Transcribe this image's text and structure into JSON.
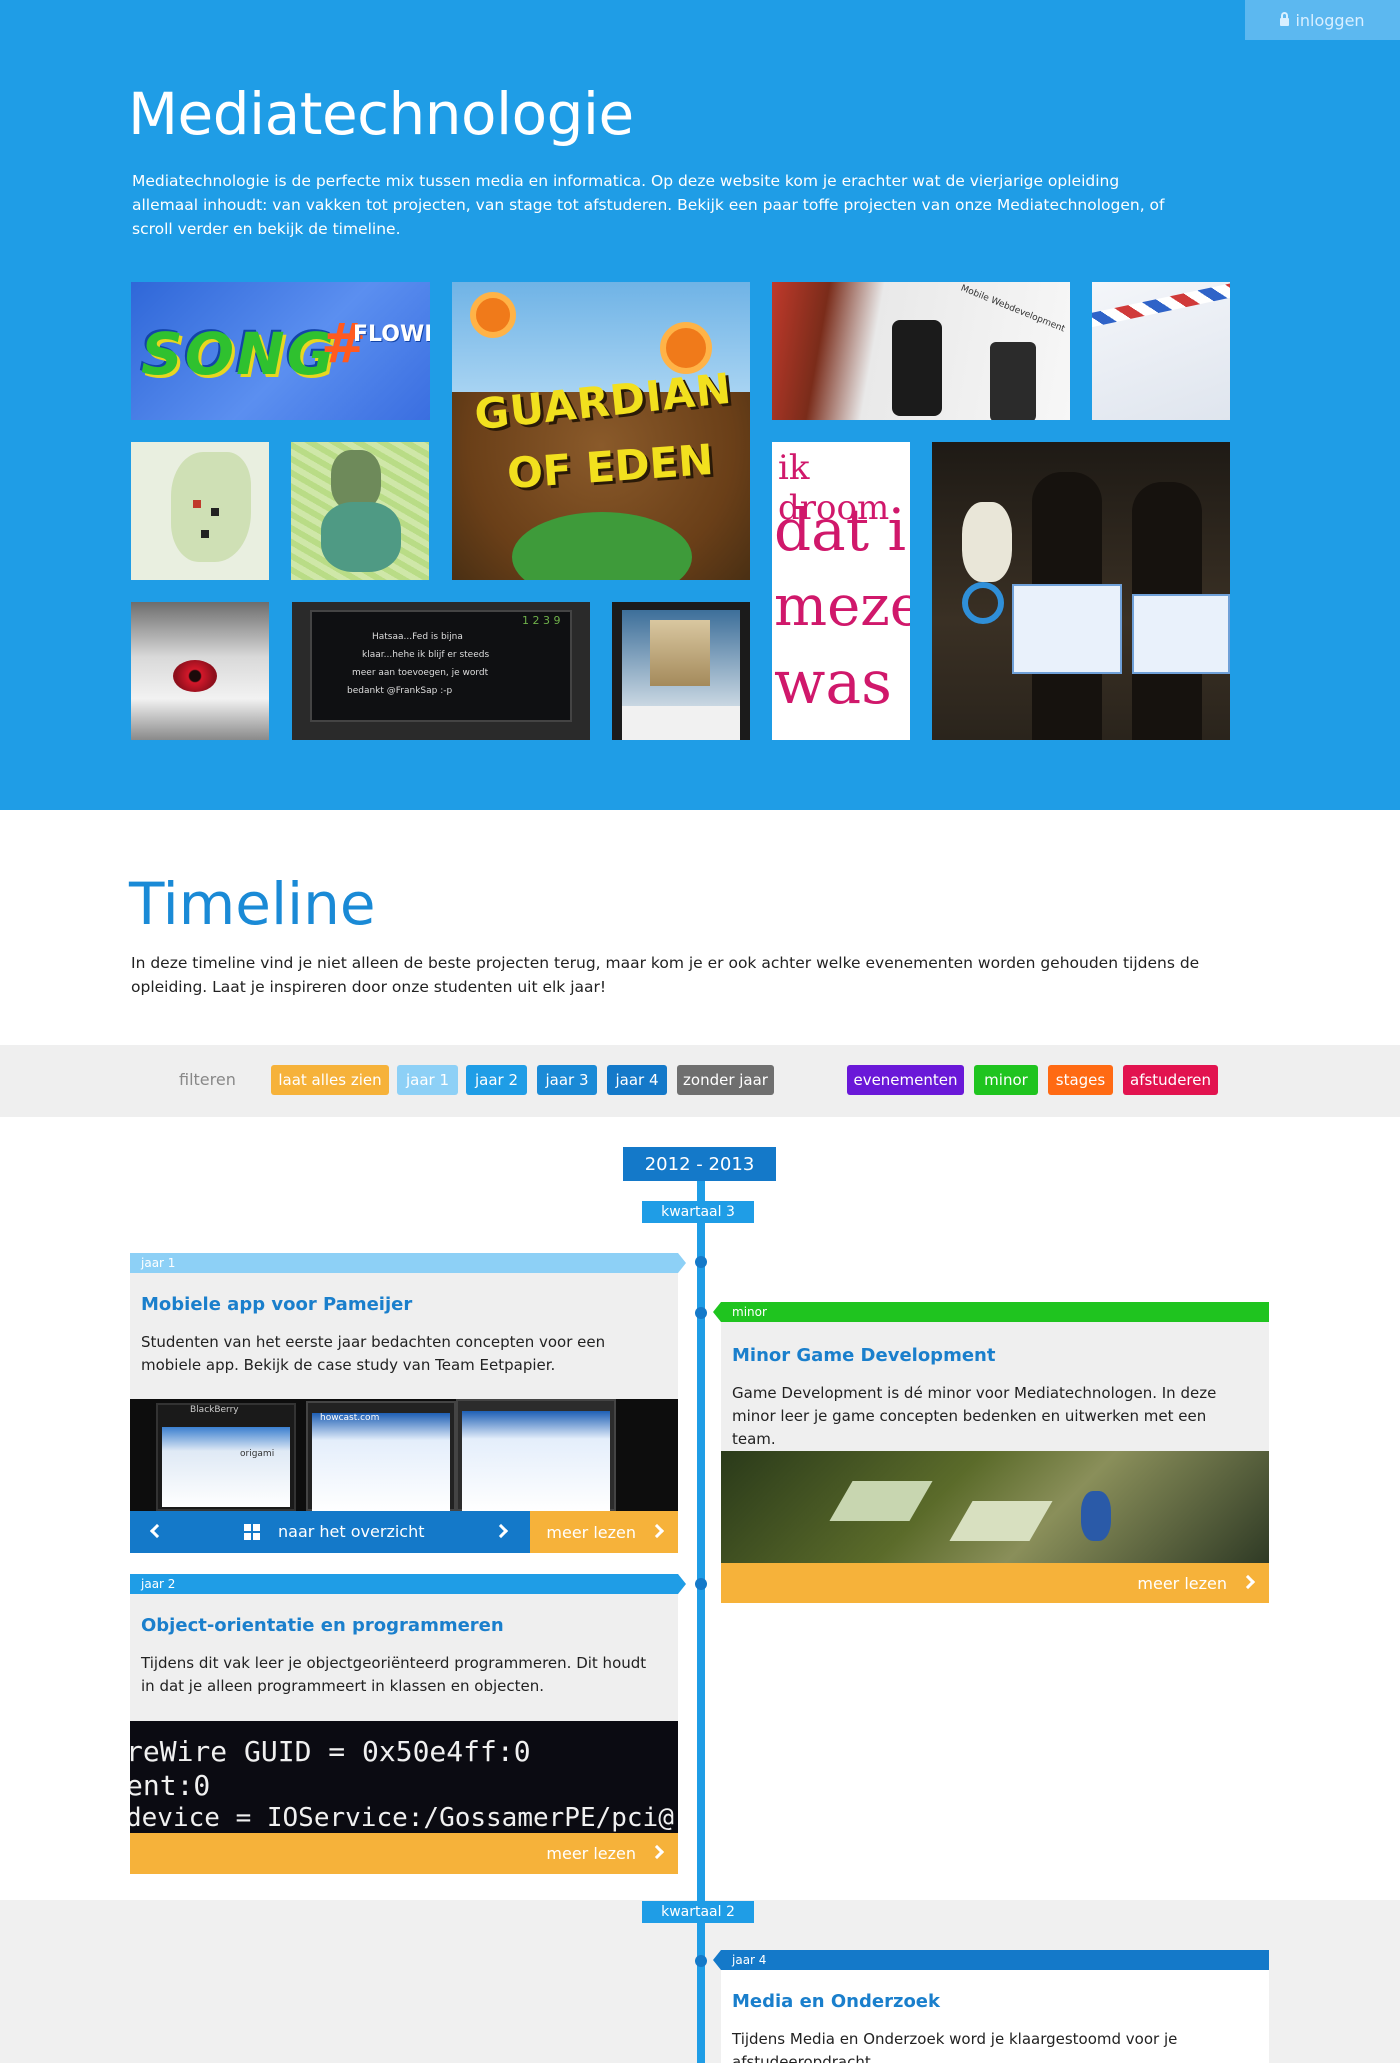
{
  "header": {
    "login_label": "inloggen",
    "title": "Mediatechnologie",
    "intro": "Mediatechnologie is de perfecte mix tussen media en informatica. Op deze website kom je erachter wat de vierjarige opleiding allemaal inhoudt: van vakken tot projecten, van stage tot afstuderen. Bekijk een paar toffe projecten van onze Mediatechnologen, of scroll verder en bekijk de timeline."
  },
  "gallery": {
    "tile_songflower_label": "SONG",
    "tile_songflower_hash": "#",
    "tile_songflower_word": "FLOWER",
    "tile_guardian_line1": "GUARDIAN",
    "tile_guardian_line2": "OF EDEN",
    "tile_droom_lines": [
      "ik droom",
      "dat i",
      "meze",
      "was"
    ],
    "tile_tablet_lines": [
      "Hatsaa...Fed is bijna",
      "klaar...hehe ik blijf er steeds",
      "meer aan toevoegen, je wordt",
      "bedankt @FrankSap :-p"
    ],
    "tile_tablet_clock": "1 2  3 9",
    "tile_mobile_label": "Mobile Webdevelopment"
  },
  "timeline": {
    "title": "Timeline",
    "intro": "In deze timeline vind je niet alleen de beste projecten terug, maar kom je er ook achter welke evenementen worden gehouden tijdens de opleiding. Laat je inspireren door onze studenten uit elk jaar!",
    "filter_label": "filteren",
    "filters": {
      "all": "laat alles zien",
      "jaar1": "jaar 1",
      "jaar2": "jaar 2",
      "jaar3": "jaar 3",
      "jaar4": "jaar 4",
      "zonder": "zonder jaar",
      "evenementen": "evenementen",
      "minor": "minor",
      "stages": "stages",
      "afstuderen": "afstuderen"
    },
    "colors": {
      "blue": "#1f9de6",
      "dark_blue": "#1479c9",
      "light_blue": "#8dd0f6",
      "orange": "#f6b23a",
      "gray": "#6f6f6f",
      "purple": "#6a18d8",
      "green": "#1fc41f",
      "deep_orange": "#ff6a13",
      "crimson": "#e2134f"
    },
    "school_year": "2012 - 2013",
    "quarter_3": "kwartaal 3",
    "quarter_2": "kwartaal 2",
    "cards": {
      "pameijer": {
        "tag": "jaar 1",
        "title": "Mobiele app voor Pameijer",
        "text": "Studenten van het eerste jaar bedachten concepten voor een mobiele app. Bekijk de case study van Team Eetpapier.",
        "overview_label": "naar het overzicht",
        "more_label": "meer lezen",
        "phone_brand": "BlackBerry",
        "phone_site": "howcast.com",
        "phone_search": "origami"
      },
      "minor_game": {
        "tag": "minor",
        "title": "Minor Game Development",
        "text": "Game Development is dé minor voor Mediatechnologen. In deze minor leer je game concepten bedenken en uitwerken met een team.",
        "more_label": "meer lezen"
      },
      "oop": {
        "tag": "jaar 2",
        "title": "Object-orientatie en programmeren",
        "text": "Tijdens dit vak leer je objectgeoriënteerd programmeren. Dit houdt in dat je alleen programmeert in klassen en objecten.",
        "code_lines": [
          "reWire GUID = 0x50e4ff:0",
          "ent:0",
          " device = IOService:/GossamerPE/pci@"
        ],
        "more_label": "meer lezen"
      },
      "media_onderzoek": {
        "tag": "jaar 4",
        "title": "Media en Onderzoek",
        "text": "Tijdens Media en Onderzoek word je klaargestoomd voor je afstudeeropdracht."
      }
    }
  }
}
